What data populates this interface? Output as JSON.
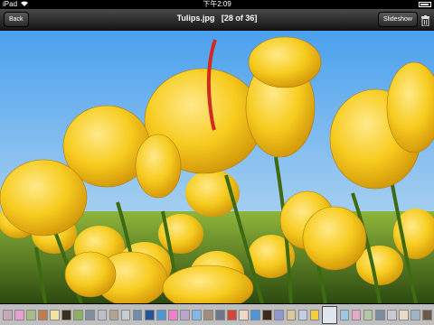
{
  "status_bar": {
    "carrier": "iPad",
    "time": "下午2:09"
  },
  "nav": {
    "back_label": "Back",
    "title": "Tulips.jpg",
    "position": "[28 of 36]",
    "slideshow_label": "Slideshow"
  },
  "photo": {
    "name": "tulips-photo"
  },
  "filmstrip": {
    "thumbs": [
      "#c8a7b8",
      "#e59fd0",
      "#a8b98a",
      "#c27a51",
      "#f1e4a1",
      "#3c2e1e",
      "#8cb05d",
      "#7d8fa0",
      "#bfbec9",
      "#b4a18f",
      "#c6ccd4",
      "#6f8ca8",
      "#2a5498",
      "#4d98d4",
      "#ef7fc9",
      "#b9a6cf",
      "#82b7e8",
      "#a28e78",
      "#6e7689",
      "#d44637",
      "#f0d8c8",
      "#4c97d7",
      "#3f2a1a",
      "#8f97d1",
      "#d7c99a",
      "#c3cfdf",
      "#f4ce3c",
      "#dfe6ee",
      "#9ac8e8",
      "#e7a8cc",
      "#b3c9a3",
      "#7a8ca0",
      "#ccc7d0",
      "#e8dbc6",
      "#a0b4c4",
      "#6a5a4a"
    ],
    "current_index": 27
  }
}
